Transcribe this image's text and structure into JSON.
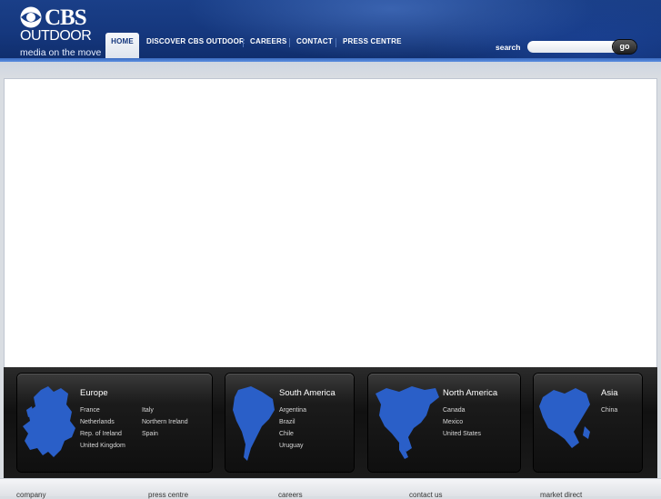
{
  "header": {
    "logo": {
      "brand": "CBS",
      "sub": "OUTDOOR",
      "tagline": "media on the move"
    },
    "nav": [
      {
        "label": "HOME"
      },
      {
        "label": "DISCOVER CBS OUTDOOR"
      },
      {
        "label": "CAREERS"
      },
      {
        "label": "CONTACT"
      },
      {
        "label": "PRESS CENTRE"
      }
    ],
    "search": {
      "label": "search",
      "placeholder": "",
      "value": "",
      "button": "go"
    }
  },
  "regions": [
    {
      "title": "Europe",
      "col1": [
        "France",
        "Netherlands",
        "Rep. of Ireland",
        "United Kingdom"
      ],
      "col2": [
        "Italy",
        "Northern Ireland",
        "Spain"
      ]
    },
    {
      "title": "South America",
      "col1": [
        "Argentina",
        "Brazil",
        "Chile",
        "Uruguay"
      ],
      "col2": []
    },
    {
      "title": "North America",
      "col1": [
        "Canada",
        "Mexico",
        "United States"
      ],
      "col2": []
    },
    {
      "title": "Asia",
      "col1": [
        "China"
      ],
      "col2": []
    }
  ],
  "footer": {
    "links": [
      "company",
      "press centre",
      "careers",
      "contact us",
      "market direct"
    ]
  },
  "colors": {
    "header": "#15377d",
    "accent": "#2b63c4",
    "map": "#2a5fc8"
  }
}
